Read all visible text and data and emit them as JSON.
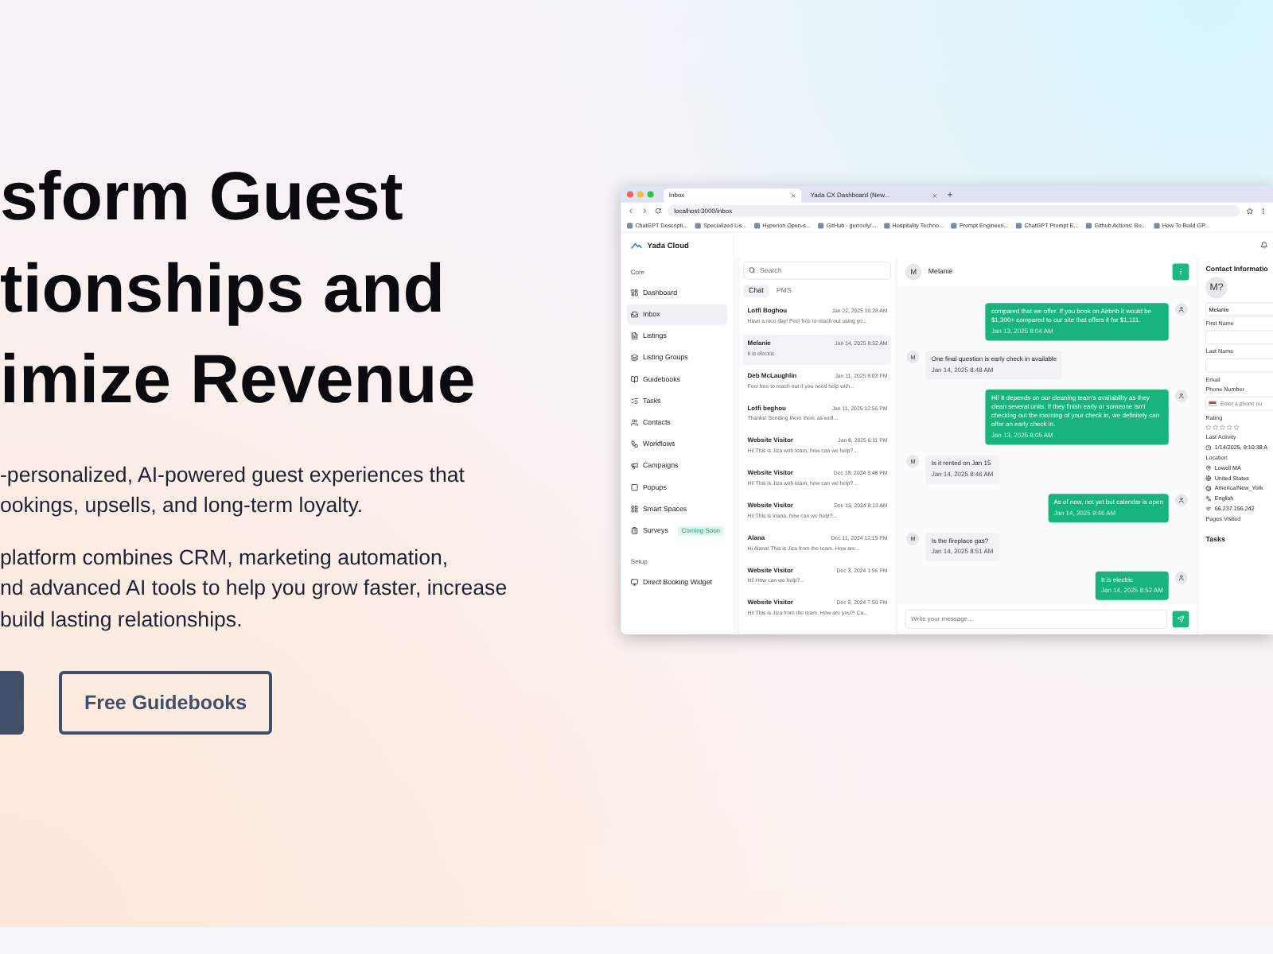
{
  "hero": {
    "heading_lines": [
      "sform Guest",
      "tionships and",
      "imize Revenue"
    ],
    "paragraphs": [
      [
        "-personalized, AI-powered guest experiences that",
        "ookings, upsells, and long-term loyalty."
      ],
      [
        "platform combines CRM, marketing automation,",
        "nd advanced AI tools to help you grow faster, increase",
        "build lasting relationships."
      ]
    ],
    "buttons": [
      {
        "kind": "primary"
      },
      {
        "kind": "outline",
        "label": "Free Guidebooks"
      }
    ]
  },
  "browser": {
    "tabs": [
      {
        "title": "Inbox",
        "selected": true
      },
      {
        "title": "Yada CX Dashboard (New...",
        "selected": false
      }
    ],
    "address": "localhost:3000/inbox",
    "bookmarks": [
      "ChatGPT Descripti...",
      "Specialized Lis...",
      "Hyperion Open-s...",
      "GitHub - gerrooly/...",
      "Hospitality Techno...",
      "Prompt Engineeri...",
      "ChatGPT Prompt E...",
      "Github Actions: Bo...",
      "How To Build GP..."
    ]
  },
  "app": {
    "brand": "Yada Cloud",
    "sidebar": {
      "sections": [
        {
          "title": "Core",
          "items": [
            {
              "label": "Dashboard",
              "selected": false
            },
            {
              "label": "Inbox",
              "selected": true
            },
            {
              "label": "Listings",
              "selected": false
            },
            {
              "label": "Listing Groups",
              "selected": false
            },
            {
              "label": "Guidebooks",
              "selected": false
            },
            {
              "label": "Tasks",
              "selected": false
            },
            {
              "label": "Contacts",
              "selected": false
            },
            {
              "label": "Workflows",
              "selected": false
            },
            {
              "label": "Campaigns",
              "selected": false
            },
            {
              "label": "Popups",
              "selected": false
            },
            {
              "label": "Smart Spaces",
              "selected": false
            },
            {
              "label": "Surveys",
              "selected": false,
              "badge": "Coming Soon"
            }
          ]
        },
        {
          "title": "Setup",
          "items": [
            {
              "label": "Direct Booking Widget",
              "selected": false
            }
          ]
        }
      ]
    },
    "inbox": {
      "search_placeholder": "Search",
      "tabs": [
        {
          "label": "Chat",
          "selected": true
        },
        {
          "label": "PMS",
          "selected": false
        }
      ],
      "conversations": [
        {
          "name": "Lotfi Boghou",
          "time": "Jan 22, 2025 10:28 AM",
          "preview": "Have a nice day! Feel free to reach out using yo...",
          "selected": false
        },
        {
          "name": "Melanie",
          "time": "Jan 14, 2025 8:52 AM",
          "preview": "It is electric",
          "selected": true
        },
        {
          "name": "Deb McLaughlin",
          "time": "Jan 11, 2025 8:03 PM",
          "preview": "Feel free to reach out if you need help with...",
          "selected": false
        },
        {
          "name": "Lotfi beghou",
          "time": "Jan 11, 2025 12:56 PM",
          "preview": "Thanks! Sending them there as well...",
          "selected": false
        },
        {
          "name": "Website Visitor",
          "time": "Jan 8, 2025 6:11 PM",
          "preview": "Hi! This is Jiza with team, how can we help?...",
          "selected": false
        },
        {
          "name": "Website Visitor",
          "time": "Dec 18, 2024 3:48 PM",
          "preview": "Hi! This is Jiza with team, how can we help?...",
          "selected": false
        },
        {
          "name": "Website Visitor",
          "time": "Dec 13, 2024 8:13 AM",
          "preview": "Hi! This is Ioana, how can we help?...",
          "selected": false
        },
        {
          "name": "Alana",
          "time": "Dec 11, 2024 12:15 PM",
          "preview": "Hi Alana! This is Jiza from the team. How are...",
          "selected": false
        },
        {
          "name": "Website Visitor",
          "time": "Dec 3, 2024 1:56 PM",
          "preview": "Hi! How can we help?...",
          "selected": false
        },
        {
          "name": "Website Visitor",
          "time": "Dec 8, 2024 7:50 PM",
          "preview": "Hi! This is Jiza from the team. How are you?! Ca...",
          "selected": false
        }
      ]
    },
    "chat": {
      "avatar": "M",
      "name": "Melanie",
      "input_placeholder": "Write your message...",
      "messages": [
        {
          "kind": "outgoing",
          "text": "compared that we offer. If you book on Airbnb it would be $1,300+ compared to our site that offers it for $1,111.",
          "time": "Jan 13, 2025 8:04 AM"
        },
        {
          "kind": "incoming",
          "avatar": "M",
          "text": "One final question is early check in available",
          "time": "Jan 14, 2025 8:48 AM"
        },
        {
          "kind": "outgoing",
          "text": "Hi! It depends on our cleaning team's availability as they clean several units. If they finish early or someone isn't checking out the morning of your check in, we definitely can offer an early check in.",
          "time": "Jan 13, 2025 8:05 AM"
        },
        {
          "kind": "incoming",
          "avatar": "M",
          "text": "Is it rented on Jan 15",
          "time": "Jan 14, 2025 8:46 AM"
        },
        {
          "kind": "outgoing",
          "text": "As of now, not yet but calendar is open",
          "time": "Jan 14, 2025 9:46 AM"
        },
        {
          "kind": "incoming",
          "avatar": "M",
          "text": "Is the fireplace gas?",
          "time": "Jan 14, 2025 8:51 AM"
        },
        {
          "kind": "outgoing",
          "text": "It is electric",
          "time": "Jan 14, 2025 8:52 AM"
        }
      ]
    },
    "contact": {
      "title": "Contact Informatio",
      "avatar": "M?",
      "items": [
        {
          "kind": "field",
          "value": "Melanie"
        },
        {
          "kind": "label",
          "text": "First Name"
        },
        {
          "kind": "field",
          "value": ""
        },
        {
          "kind": "label",
          "text": "Last Name"
        },
        {
          "kind": "field",
          "value": ""
        },
        {
          "kind": "label",
          "text": "Email"
        },
        {
          "kind": "label",
          "text": "Phone Number"
        },
        {
          "kind": "phone",
          "placeholder": "Enter a phone nu"
        },
        {
          "kind": "label",
          "text": "Rating"
        },
        {
          "kind": "stars",
          "stars": 0
        },
        {
          "kind": "label",
          "text": "Last Activity"
        },
        {
          "kind": "info",
          "text": "1/14/2025, 9:10:38 A"
        },
        {
          "kind": "label",
          "text": "Location"
        },
        {
          "kind": "info",
          "text": "Lowell MA"
        },
        {
          "kind": "info",
          "text": "United States"
        },
        {
          "kind": "info",
          "text": "America/New_York"
        },
        {
          "kind": "info",
          "text": "English"
        },
        {
          "kind": "info",
          "text": "66.237.156.242"
        },
        {
          "kind": "label",
          "text": "Pages Visited"
        }
      ],
      "tasks_title": "Tasks"
    }
  }
}
